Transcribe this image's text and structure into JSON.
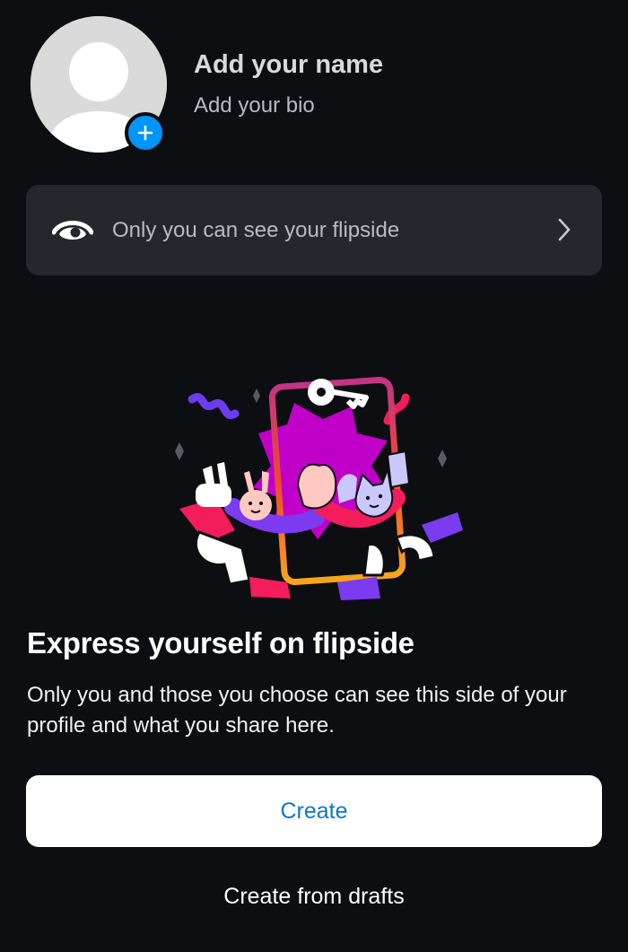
{
  "profile": {
    "name_placeholder": "Add your name",
    "bio_placeholder": "Add your bio",
    "avatar_icon": "default-avatar-icon",
    "add_photo_icon": "plus-icon"
  },
  "privacy": {
    "label": "Only you can see your flipside",
    "icon": "eye-icon",
    "chevron_icon": "chevron-right-icon"
  },
  "promo": {
    "illustration": "flipside-illustration",
    "headline": "Express yourself on flipside",
    "description": "Only you and those you choose can see this side of your profile and what you share here."
  },
  "actions": {
    "create_label": "Create",
    "drafts_label": "Create from drafts"
  },
  "colors": {
    "background": "#0d0e12",
    "card": "#25272c",
    "accent_blue": "#0095f6",
    "create_text": "#0a78c8"
  }
}
